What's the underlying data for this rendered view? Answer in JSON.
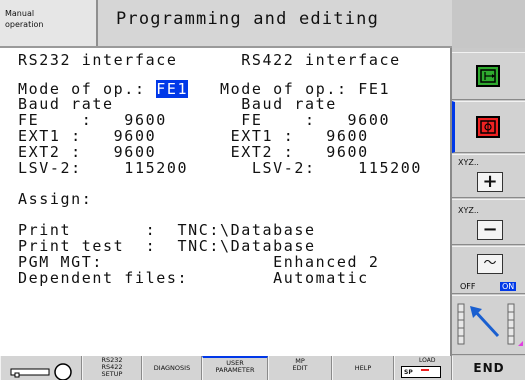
{
  "header": {
    "mode": "Manual\noperation",
    "title": "Programming and editing"
  },
  "screen": {
    "lines": [
      "RS232 interface      RS422 interface",
      "",
      "Mode of op.:",
      "FE1",
      "   Mode of op.: FE1",
      "Baud rate            Baud rate",
      "FE    :   9600       FE    :   9600",
      "EXT1 :   9600       EXT1 :   9600",
      "EXT2 :   9600       EXT2 :   9600",
      "LSV-2:    115200      LSV-2:    115200",
      "Assign:",
      "Print       :  TNC:\\Database",
      "Print test  :  TNC:\\Database",
      "PGM MGT:                Enhanced 2",
      "Dependent files:        Automatic"
    ]
  },
  "sidebar": {
    "xyz_plus_label": "XYZ..",
    "xyz_minus_label": "XYZ..",
    "plus_symbol": "+",
    "minus_symbol": "−",
    "off_label": "OFF",
    "on_label": "ON",
    "wave_symbol": "〜",
    "green_icon": "window-green-icon",
    "red_icon": "window-red-icon",
    "arrow_icon": "diagonal-arrow-icon"
  },
  "softkeys": {
    "key_icon": "key-icon",
    "rs_setup": "RS232\nRS422\nSETUP",
    "diagnosis": "DIAGNOSIS",
    "user_parameter": "USER\nPARAMETER",
    "mp_edit": "MP\nEDIT",
    "help": "HELP",
    "load_label": "LOAD",
    "sp_label": "SP",
    "end": "END"
  },
  "colors": {
    "highlight": "#0038e8",
    "green": "#2faa2f",
    "red": "#ee2222"
  }
}
